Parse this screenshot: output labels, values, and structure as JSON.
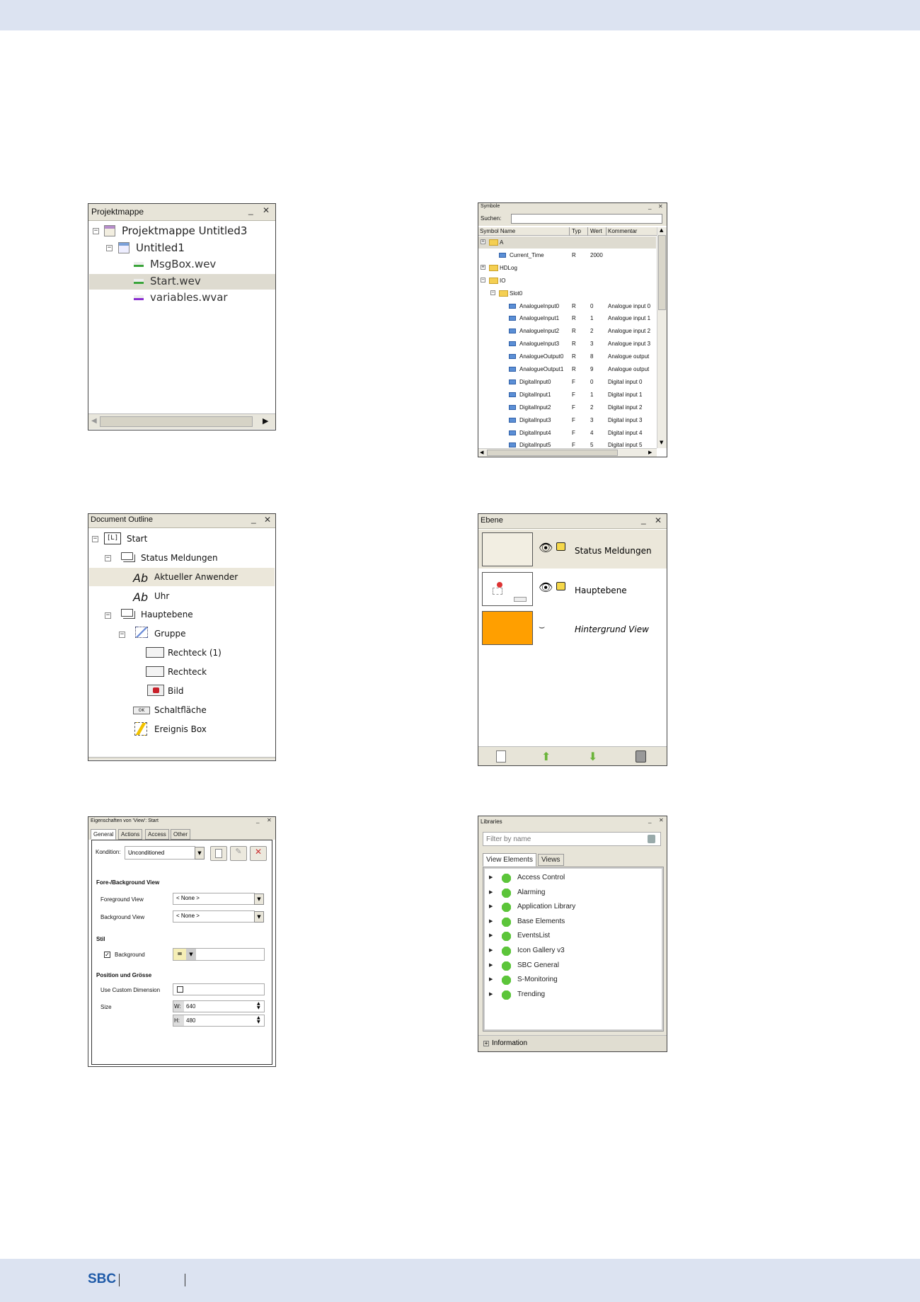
{
  "footer": {
    "brand": "SBC"
  },
  "projekt": {
    "title": "Projektmappe",
    "minimize": "_",
    "close": "✕",
    "items": [
      "Projektmappe Untitled3",
      "Untitled1",
      "MsgBox.wev",
      "Start.wev",
      "variables.wvar"
    ]
  },
  "symbole": {
    "title": "Symbole",
    "search_label": "Suchen:",
    "search_value": "",
    "columns": [
      "Symbol Name",
      "Typ",
      "Wert",
      "Kommentar"
    ],
    "rows": [
      {
        "name": "A",
        "typ": "",
        "wert": "",
        "kommentar": ""
      },
      {
        "name": "Current_Time",
        "typ": "R",
        "wert": "2000",
        "kommentar": ""
      },
      {
        "name": "HDLog",
        "typ": "",
        "wert": "",
        "kommentar": ""
      },
      {
        "name": "IO",
        "typ": "",
        "wert": "",
        "kommentar": ""
      },
      {
        "name": "Slot0",
        "typ": "",
        "wert": "",
        "kommentar": ""
      },
      {
        "name": "AnalogueInput0",
        "typ": "R",
        "wert": "0",
        "kommentar": "Analogue input 0"
      },
      {
        "name": "AnalogueInput1",
        "typ": "R",
        "wert": "1",
        "kommentar": "Analogue input 1"
      },
      {
        "name": "AnalogueInput2",
        "typ": "R",
        "wert": "2",
        "kommentar": "Analogue input 2"
      },
      {
        "name": "AnalogueInput3",
        "typ": "R",
        "wert": "3",
        "kommentar": "Analogue input 3"
      },
      {
        "name": "AnalogueOutput0",
        "typ": "R",
        "wert": "8",
        "kommentar": "Analogue output"
      },
      {
        "name": "AnalogueOutput1",
        "typ": "R",
        "wert": "9",
        "kommentar": "Analogue output"
      },
      {
        "name": "DigitalInput0",
        "typ": "F",
        "wert": "0",
        "kommentar": "Digital input 0"
      },
      {
        "name": "DigitalInput1",
        "typ": "F",
        "wert": "1",
        "kommentar": "Digital input 1"
      },
      {
        "name": "DigitalInput2",
        "typ": "F",
        "wert": "2",
        "kommentar": "Digital input 2"
      },
      {
        "name": "DigitalInput3",
        "typ": "F",
        "wert": "3",
        "kommentar": "Digital input 3"
      },
      {
        "name": "DigitalInput4",
        "typ": "F",
        "wert": "4",
        "kommentar": "Digital input 4"
      },
      {
        "name": "DigitalInput5",
        "typ": "F",
        "wert": "5",
        "kommentar": "Digital input 5"
      }
    ]
  },
  "outline": {
    "title": "Document Outline",
    "items": [
      "Start",
      "Status Meldungen",
      "Aktueller Anwender",
      "Uhr",
      "Hauptebene",
      "Gruppe",
      "Rechteck (1)",
      "Rechteck",
      "Bild",
      "Schaltfläche",
      "Ereignis Box"
    ],
    "ab": "Ab",
    "ok": "OK"
  },
  "ebene": {
    "title": "Ebene",
    "layers": [
      "Status Meldungen",
      "Hauptebene",
      "Hintergrund View"
    ],
    "accent": "#ff9f00"
  },
  "eigen": {
    "title": "Eigenschaften von 'View': Start",
    "tabs": [
      "General",
      "Actions",
      "Access",
      "Other"
    ],
    "kondition_label": "Kondition:",
    "kondition_value": "Unconditioned",
    "sec1": "Fore-/Background View",
    "fg_label": "Foreground View",
    "fg_value": "< None >",
    "bg_label": "Background View",
    "bg_value": "< None >",
    "sec2": "Stil",
    "background_label": "Background",
    "eq": "=",
    "sec3": "Position und Grösse",
    "custom_label": "Use Custom Dimension",
    "size_label": "Size",
    "w_label": "W:",
    "w_value": "640",
    "h_label": "H:",
    "h_value": "480"
  },
  "libs": {
    "title": "Libraries",
    "filter_placeholder": "Filter by name",
    "tabs": [
      "View Elements",
      "Views"
    ],
    "items": [
      "Access Control",
      "Alarming",
      "Application Library",
      "Base Elements",
      "EventsList",
      "Icon Gallery v3",
      "SBC General",
      "S-Monitoring",
      "Trending"
    ],
    "info": "Information"
  }
}
